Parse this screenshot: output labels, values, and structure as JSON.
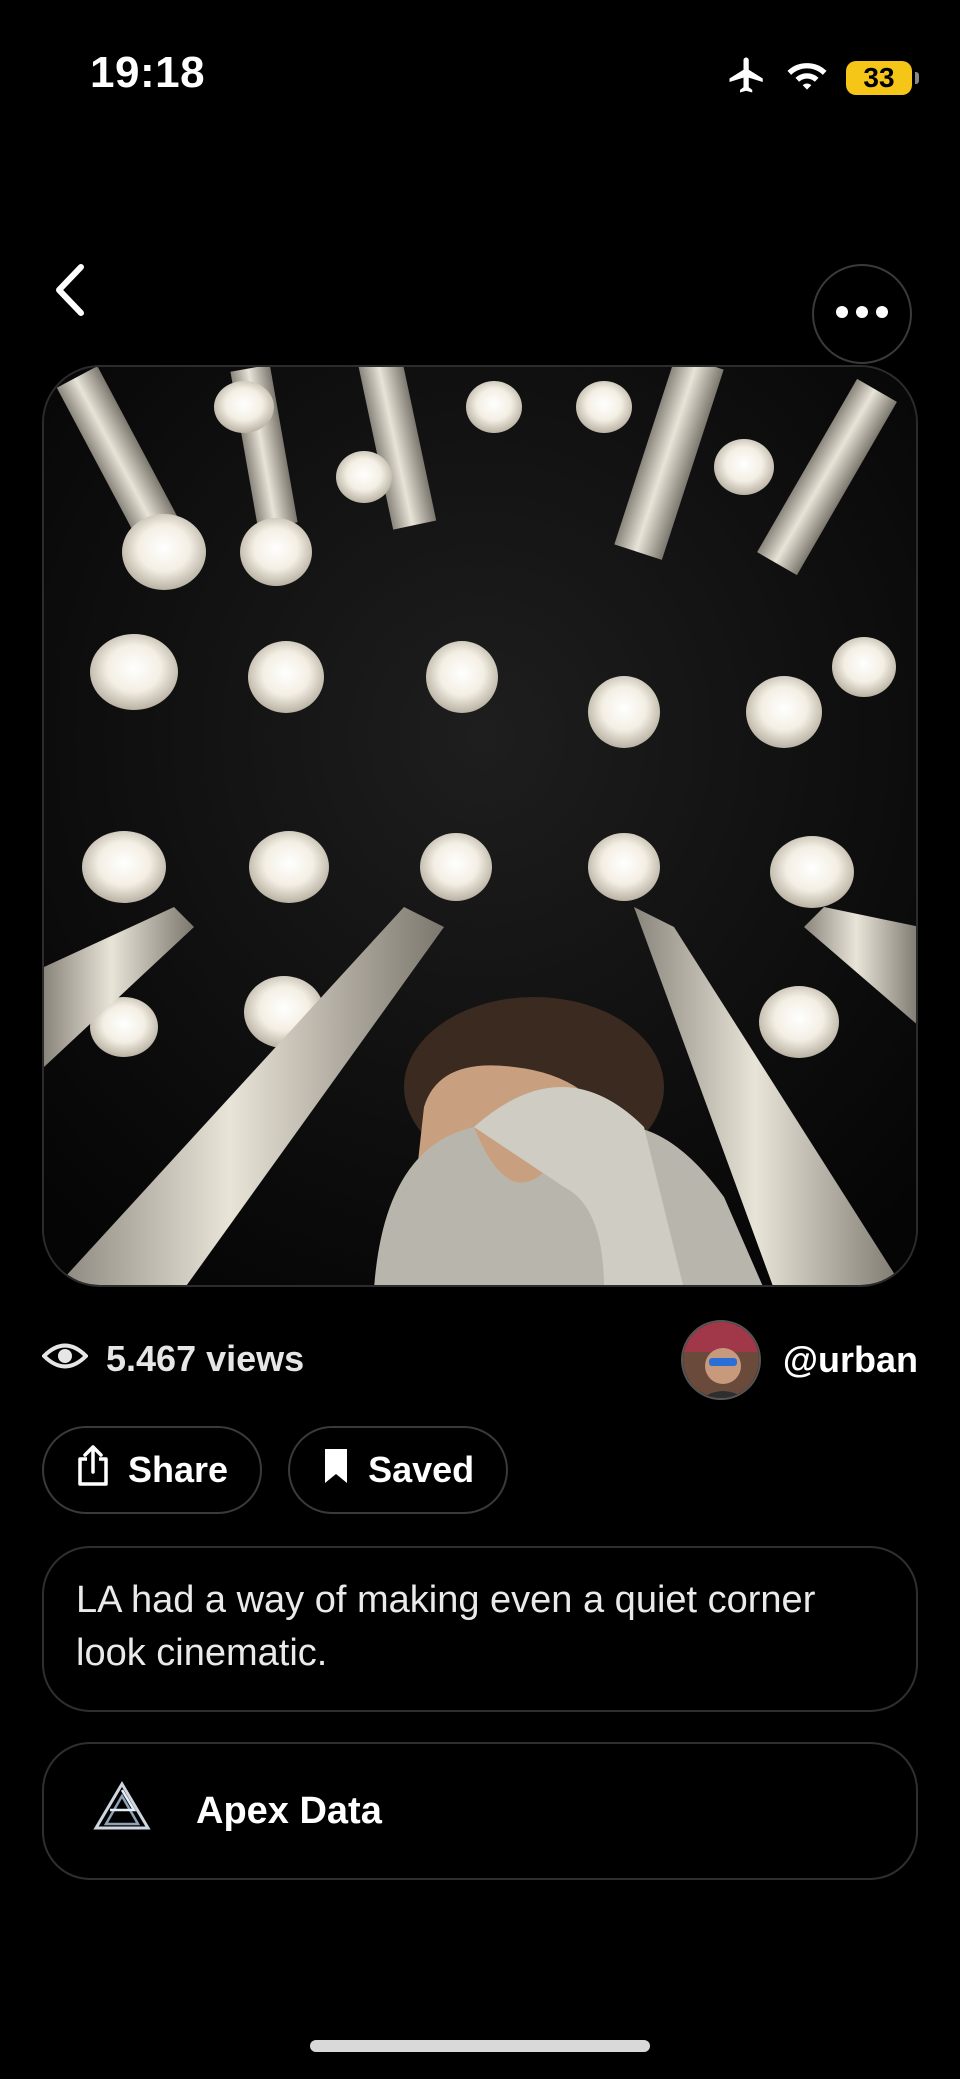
{
  "status_bar": {
    "time": "19:18",
    "battery": "33"
  },
  "icons": {
    "back": "chevron-left-icon",
    "more": "ellipsis-icon",
    "views": "eye-icon",
    "share": "share-icon",
    "saved": "bookmark-icon",
    "apex": "apex-logo"
  },
  "post": {
    "views_label": "5.467 views",
    "author_handle": "@urban",
    "caption": "LA had a way of making even a quiet corner look cinematic."
  },
  "actions": {
    "share_label": "Share",
    "saved_label": "Saved"
  },
  "collection": {
    "name": "Apex Data"
  },
  "colors": {
    "background": "#000000",
    "battery": "#f5c518"
  }
}
